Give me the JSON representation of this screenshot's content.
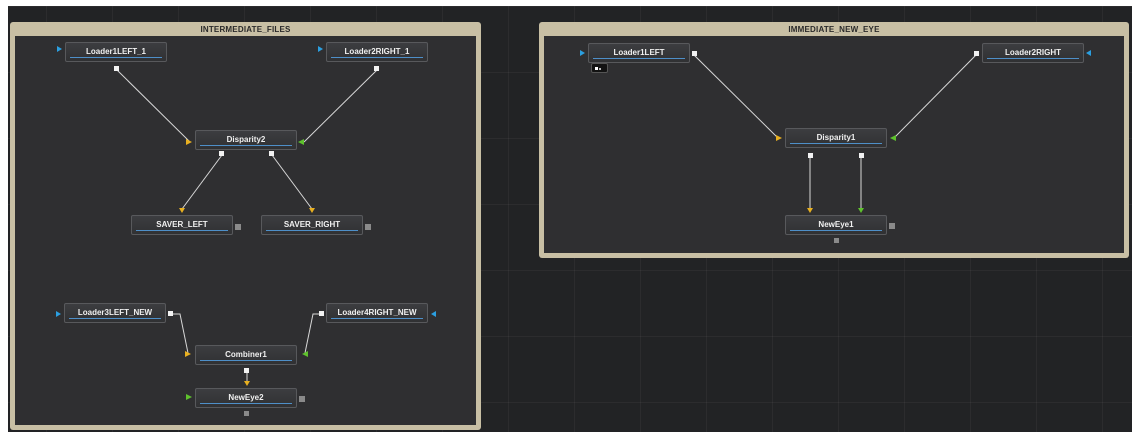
{
  "groups": {
    "left_title": "INTERMEDIATE_FILES",
    "right_title": "IMMEDIATE_NEW_EYE"
  },
  "nodes": {
    "loader1_left_1": "Loader1LEFT_1",
    "loader2_right_1": "Loader2RIGHT_1",
    "disparity2": "Disparity2",
    "saver_left": "SAVER_LEFT",
    "saver_right": "SAVER_RIGHT",
    "loader3_left_new": "Loader3LEFT_NEW",
    "loader4_right_new": "Loader4RIGHT_NEW",
    "combiner1": "Combiner1",
    "neweye2": "NewEye2",
    "loader1_left": "Loader1LEFT",
    "loader2_right": "Loader2RIGHT",
    "disparity1": "Disparity1",
    "neweye1": "NewEye1"
  },
  "colors": {
    "input_main": "#e8b020",
    "input_secondary": "#5fc22d",
    "input_blue": "#2b9fe0",
    "wire": "#d8d8d8",
    "group_frame": "#c8bfa4"
  }
}
